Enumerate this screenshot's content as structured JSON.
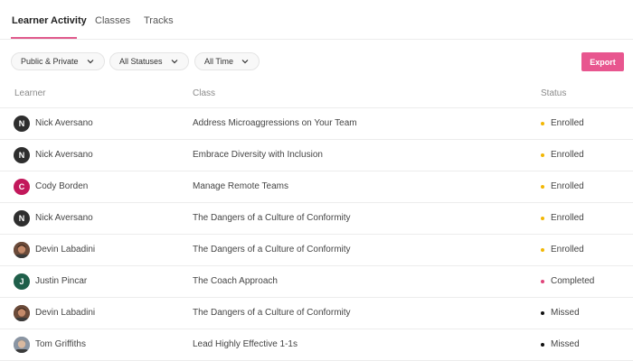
{
  "tabs": [
    {
      "label": "Learner Activity",
      "active": true
    },
    {
      "label": "Classes",
      "active": false
    },
    {
      "label": "Tracks",
      "active": false
    }
  ],
  "filters": {
    "visibility": "Public & Private",
    "status": "All Statuses",
    "time": "All Time"
  },
  "export_label": "Export",
  "colors": {
    "accent": "#e8568f",
    "enrolled": "#f2b705",
    "completed": "#e0457b",
    "missed": "#111111"
  },
  "table": {
    "headers": {
      "learner": "Learner",
      "class": "Class",
      "status": "Status"
    },
    "rows": [
      {
        "initial": "N",
        "avatar_color": "#2e2e2e",
        "avatar_type": "initial",
        "learner": "Nick Aversano",
        "class": "Address Microaggressions on Your Team",
        "status": "Enrolled"
      },
      {
        "initial": "N",
        "avatar_color": "#2e2e2e",
        "avatar_type": "initial",
        "learner": "Nick Aversano",
        "class": "Embrace Diversity with Inclusion",
        "status": "Enrolled"
      },
      {
        "initial": "C",
        "avatar_color": "#c2185b",
        "avatar_type": "initial",
        "learner": "Cody Borden",
        "class": "Manage Remote Teams",
        "status": "Enrolled"
      },
      {
        "initial": "N",
        "avatar_color": "#2e2e2e",
        "avatar_type": "initial",
        "learner": "Nick Aversano",
        "class": "The Dangers of a Culture of Conformity",
        "status": "Enrolled"
      },
      {
        "initial": "",
        "avatar_color": "#6b4b3a",
        "avatar_type": "photo",
        "learner": "Devin Labadini",
        "class": "The Dangers of a Culture of Conformity",
        "status": "Enrolled"
      },
      {
        "initial": "J",
        "avatar_color": "#1f5f4a",
        "avatar_type": "initial",
        "learner": "Justin Pincar",
        "class": "The Coach Approach",
        "status": "Completed"
      },
      {
        "initial": "",
        "avatar_color": "#6b4b3a",
        "avatar_type": "photo",
        "learner": "Devin Labadini",
        "class": "The Dangers of a Culture of Conformity",
        "status": "Missed"
      },
      {
        "initial": "",
        "avatar_color": "#8a95a3",
        "avatar_type": "photo",
        "learner": "Tom Griffiths",
        "class": "Lead Highly Effective 1-1s",
        "status": "Missed"
      }
    ]
  }
}
